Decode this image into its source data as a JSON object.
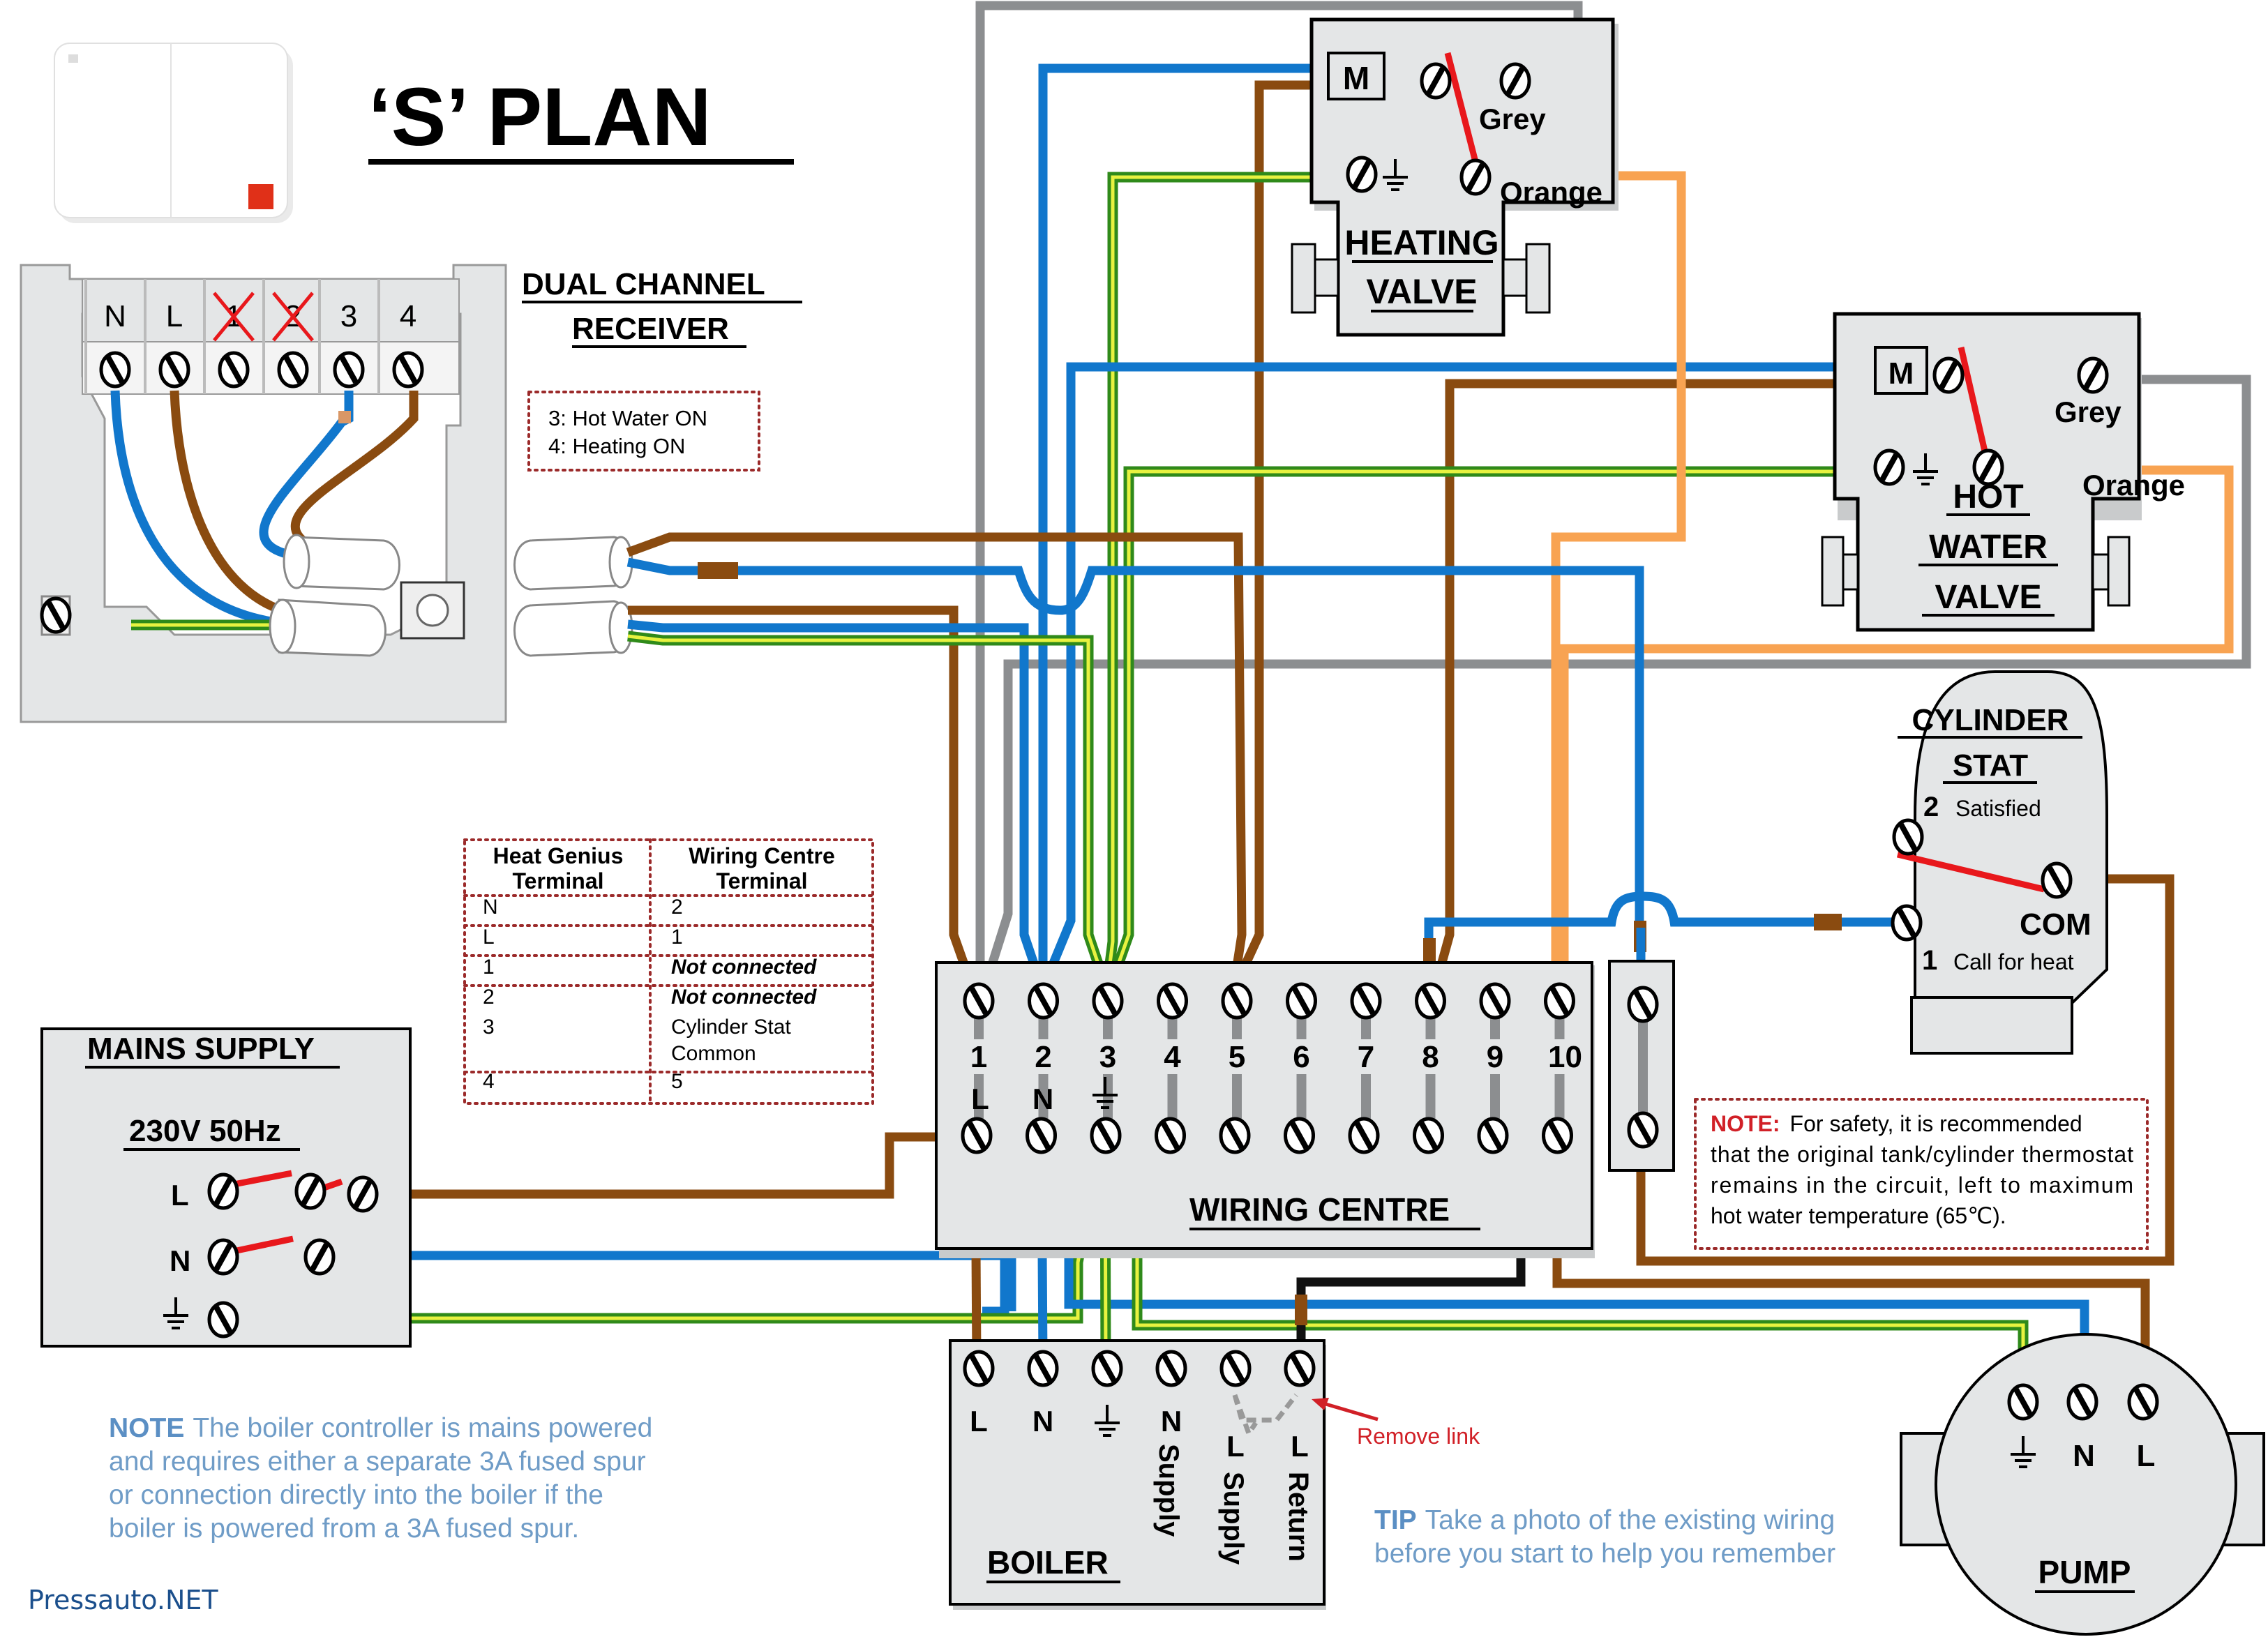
{
  "title": "‘S’ PLAN",
  "watermark": "Pressauto.NET",
  "colors": {
    "live_brown": "#8a4b10",
    "neutral_blue": "#1177cc",
    "earth_green": "#2f8a1a",
    "earth_yellow": "#e8f240",
    "grey": "#8c8e90",
    "orange": "#f8a352",
    "switch_red": "#e8181c",
    "note_red": "#d12027",
    "note_blue": "#6f9cc7",
    "table_border": "#9b2a2a"
  },
  "receiver": {
    "heading_line1": "DUAL CHANNEL",
    "heading_line2": "RECEIVER",
    "terminals": [
      "N",
      "L",
      "1",
      "2",
      "3",
      "4"
    ],
    "crossed_terminals": [
      "1",
      "2"
    ],
    "legend": [
      "3: Hot Water ON",
      "4: Heating ON"
    ]
  },
  "mapping_table": {
    "headers": [
      [
        "Heat Genius",
        "Terminal"
      ],
      [
        "Wiring Centre",
        "Terminal"
      ]
    ],
    "rows": [
      {
        "heat_genius": "N",
        "wiring_centre": "2",
        "italic": false
      },
      {
        "heat_genius": "L",
        "wiring_centre": "1",
        "italic": false
      },
      {
        "heat_genius": "1",
        "wiring_centre": "Not connected",
        "italic": true
      },
      {
        "heat_genius": "2",
        "wiring_centre": "Not connected",
        "italic": true
      },
      {
        "heat_genius": "3",
        "wiring_centre": "Cylinder Stat",
        "wiring_centre_line2": "Common",
        "italic": false
      },
      {
        "heat_genius": "4",
        "wiring_centre": "5",
        "italic": false
      }
    ]
  },
  "heating_valve": {
    "motor_label": "M",
    "grey_label": "Grey",
    "orange_label": "Orange",
    "title_line1": "HEATING",
    "title_line2": "VALVE"
  },
  "hot_water_valve": {
    "motor_label": "M",
    "grey_label": "Grey",
    "orange_label": "Orange",
    "title_line1": "HOT",
    "title_line2": "WATER",
    "title_line3": "VALVE"
  },
  "cylinder_stat": {
    "title_line1": "CYLINDER",
    "title_line2": "STAT",
    "terminal2_num": "2",
    "terminal2_label": "Satisfied",
    "com_label": "COM",
    "terminal1_num": "1",
    "terminal1_label": "Call for heat"
  },
  "mains_supply": {
    "title": "MAINS SUPPLY",
    "rating": "230V 50Hz",
    "terminals": [
      "L",
      "N",
      "⏚"
    ]
  },
  "wiring_centre": {
    "title": "WIRING CENTRE",
    "terminal_numbers": [
      "1",
      "2",
      "3",
      "4",
      "5",
      "6",
      "7",
      "8",
      "9",
      "10"
    ],
    "function_labels": [
      "L",
      "N",
      "⏚"
    ]
  },
  "boiler": {
    "title": "BOILER",
    "terminals": [
      "L",
      "N",
      "⏚",
      "N",
      "L",
      "L"
    ],
    "vertical_labels": [
      "Supply",
      "Supply",
      "Return"
    ],
    "remove_link_label": "Remove link"
  },
  "pump": {
    "title": "PUMP",
    "terminals": [
      "⏚",
      "N",
      "L"
    ]
  },
  "notes": {
    "safety_prefix": "NOTE:",
    "safety_lines": [
      "For safety, it is recommended",
      "that the original tank/cylinder thermostat",
      "remains in the circuit, left to maximum",
      "hot water temperature (65℃)."
    ],
    "mains_prefix": "NOTE",
    "mains_lines": [
      "The boiler controller is mains powered",
      "and requires either a separate 3A fused spur",
      "or connection directly into the boiler if the",
      "boiler is powered from a 3A fused spur."
    ],
    "tip_prefix": "TIP",
    "tip_lines": [
      "Take a photo of the existing wiring",
      "before you start to help you remember"
    ]
  }
}
